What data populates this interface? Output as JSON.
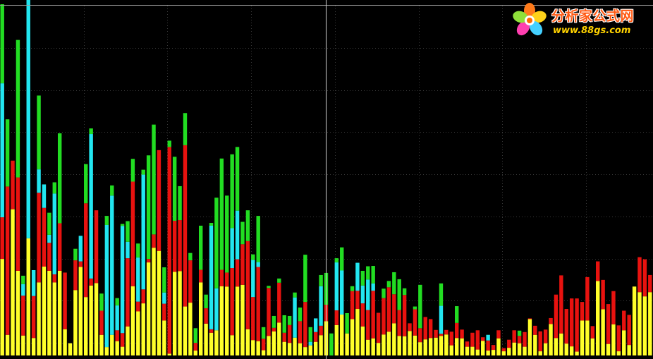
{
  "chart_data": {
    "type": "bar",
    "stacked": true,
    "ylim": [
      0,
      100
    ],
    "grid": true,
    "colors": {
      "yellow": "#ffff2a",
      "red": "#e8120f",
      "cyan": "#22e6f0",
      "green": "#22dd22",
      "background": "#000000",
      "gridline": "#3a3a3a",
      "axis": "#9a9a9a",
      "crosshair": "#d0d0d0"
    },
    "stack_order": [
      "yellow",
      "red",
      "cyan",
      "green"
    ],
    "series": [
      {
        "name": "",
        "color": "yellow",
        "values": [
          27.6,
          5.9,
          41.8,
          24.2,
          5.7,
          33.5,
          5.0,
          20.9,
          25.4,
          24.2,
          20.9,
          24.2,
          7.5,
          3.5,
          18.7,
          25.3,
          16.7,
          20.0,
          20.7,
          5.9,
          2.4,
          5.9,
          4.1,
          2.5,
          8.3,
          19.8,
          12.6,
          14.9,
          26.6,
          30.8,
          29.9,
          10.0,
          0.5,
          23.9,
          24.1,
          14.0,
          15.1,
          1.4,
          20.9,
          9.1,
          6.5,
          7.2,
          19.8,
          19.7,
          5.8,
          19.7,
          20.2,
          7.5,
          4.4,
          4.1,
          1.5,
          5.6,
          6.9,
          9.4,
          3.9,
          3.6,
          5.1,
          3.5,
          2.4,
          2.9,
          3.9,
          5.8,
          9.8,
          0,
          8.7,
          11.7,
          6.3,
          10.4,
          13.3,
          8.3,
          4.5,
          4.9,
          3.6,
          6.0,
          6.8,
          9.2,
          5.6,
          5.5,
          7.0,
          5.7,
          3.8,
          4.6,
          5.0,
          5.1,
          5.6,
          6.0,
          2.9,
          5.0,
          4.9,
          2.5,
          2.5,
          1.7,
          4.2,
          1.4,
          1.6,
          4.9,
          1.2,
          2.2,
          3.7,
          3.5,
          2.5,
          10.4,
          5.9,
          1.2,
          3.5,
          9.0,
          5.0,
          6.3,
          3.4,
          2.6,
          1.1,
          10.0,
          10.0,
          4.9,
          21.3,
          13.2,
          3.3,
          8.9,
          1.2,
          7.2,
          3.0,
          19.7,
          18.1,
          16.9,
          18.1
        ]
      },
      {
        "name": "",
        "color": "red",
        "values": [
          11.9,
          42.4,
          13.9,
          26.7,
          11.4,
          0,
          12.0,
          25.6,
          16.8,
          8.0,
          2.3,
          13.6,
          16.2,
          0,
          8.5,
          1.6,
          26.8,
          2.0,
          20.8,
          6.9,
          0,
          0,
          3.1,
          3.9,
          19.5,
          29.9,
          2.8,
          4.0,
          1.0,
          3.8,
          28.8,
          4.8,
          59.1,
          14.6,
          14.6,
          46.1,
          12.1,
          2.2,
          3.6,
          4.4,
          1.0,
          0,
          4.7,
          4.0,
          19.2,
          7.8,
          11.6,
          25.2,
          12.3,
          21.2,
          3.3,
          13.7,
          1.0,
          11.4,
          2.6,
          5.1,
          0,
          6.3,
          12.9,
          0,
          2.8,
          2.7,
          4.7,
          0,
          4.2,
          0,
          0,
          8.0,
          5.2,
          6.6,
          8.5,
          13.6,
          8.6,
          10.4,
          12.7,
          8.3,
          7.4,
          11.8,
          2.2,
          7.5,
          4.0,
          6.4,
          5.4,
          2.2,
          0.6,
          1.3,
          3.9,
          4.3,
          2.5,
          1.5,
          4.0,
          5.5,
          1.0,
          2.9,
          1.4,
          2.3,
          0.9,
          2.3,
          3.5,
          2.1,
          4.2,
          0.2,
          2.6,
          5.7,
          3.9,
          1.7,
          12.4,
          16.6,
          9.9,
          13.7,
          15.2,
          5.3,
          12.4,
          3.5,
          5.6,
          8.4,
          11.4,
          9.5,
          7.4,
          5.6,
          8.6,
          0,
          10.0,
          10.6,
          4.9
        ]
      },
      {
        "name": "",
        "color": "cyan",
        "values": [
          38.3,
          0,
          0,
          0,
          3.3,
          73.2,
          7.4,
          6.7,
          6.7,
          2.3,
          23.1,
          0,
          0,
          0,
          0,
          7.3,
          0,
          41.3,
          0,
          0,
          34.9,
          39.8,
          7.1,
          30.6,
          4.7,
          0,
          12.6,
          32.8,
          0,
          0,
          0,
          3.2,
          0,
          0,
          0,
          0,
          0,
          0,
          0,
          0,
          29.6,
          12.0,
          0,
          0,
          11.4,
          13.9,
          0,
          0,
          10.6,
          1.4,
          0,
          0,
          0,
          0,
          0,
          0,
          11.5,
          0,
          0,
          1.0,
          3.9,
          11.3,
          0,
          0,
          13.7,
          12.6,
          0,
          0,
          8.0,
          5.1,
          8.7,
          2.1,
          0,
          0,
          0,
          0,
          0,
          0,
          0,
          0,
          0,
          0,
          0,
          0,
          8.0,
          0,
          0,
          0,
          0,
          0,
          0,
          0,
          0,
          1.6,
          0,
          0,
          0,
          0,
          0,
          0,
          0,
          0,
          0,
          0,
          0,
          0,
          0,
          0,
          0,
          0,
          0,
          0,
          0,
          0,
          0,
          0,
          0,
          0,
          0,
          0,
          0,
          0,
          0,
          0,
          0
        ]
      },
      {
        "name": "",
        "color": "green",
        "values": [
          22.6,
          19.2,
          0,
          39.3,
          2.4,
          0,
          0,
          21.1,
          0,
          6.3,
          3.2,
          25.7,
          0,
          0,
          3.3,
          0,
          11.2,
          1.6,
          0,
          4.9,
          2.6,
          2.9,
          2.1,
          0.6,
          5.9,
          6.5,
          4.0,
          1.4,
          29.6,
          31.4,
          0,
          7.2,
          1.8,
          18.3,
          9.7,
          9.2,
          2.1,
          4.2,
          12.6,
          3.9,
          0.8,
          25.9,
          31.8,
          22.0,
          21.1,
          18.2,
          6.4,
          8.8,
          1.6,
          13.2,
          3.3,
          0.6,
          3.4,
          1.2,
          5.0,
          2.6,
          1.4,
          3.9,
          13.5,
          4.2,
          0,
          3.2,
          9.1,
          6.3,
          1.2,
          6.6,
          5.8,
          1.4,
          0,
          4.2,
          3.8,
          5.0,
          0,
          2.7,
          1.8,
          6.3,
          8.8,
          1.9,
          0,
          0.8,
          12.4,
          0,
          0,
          0,
          6.4,
          0,
          0,
          4.8,
          0,
          0,
          0,
          0,
          0,
          0,
          0,
          0,
          0,
          0,
          0,
          1.5,
          0,
          0,
          0,
          0,
          0,
          0,
          0,
          0,
          0,
          0,
          0,
          0,
          0,
          0,
          0,
          0,
          0,
          0,
          0,
          0,
          0,
          0,
          0,
          0,
          0,
          0,
          0
        ]
      }
    ]
  },
  "logo": {
    "title": "分析家公式网",
    "url": "www.88gs.com"
  }
}
